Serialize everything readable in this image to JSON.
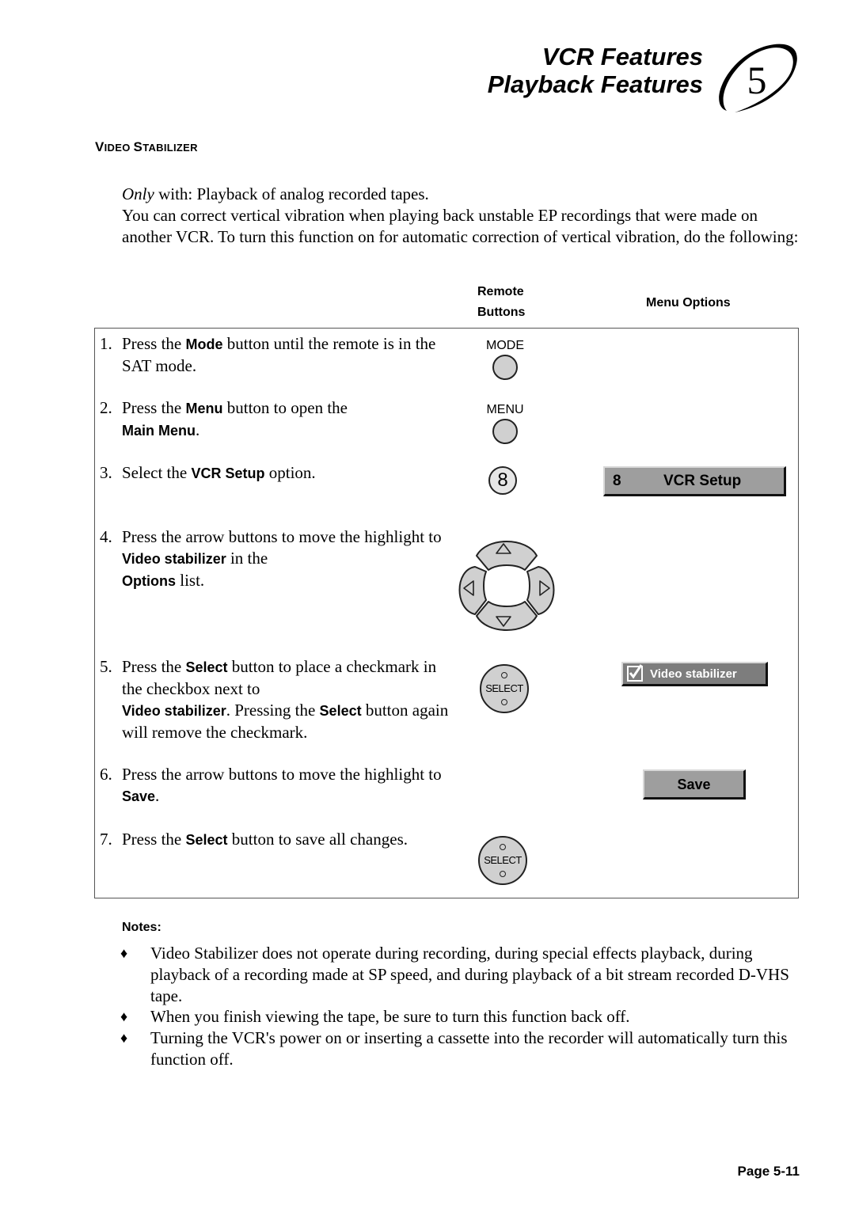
{
  "header": {
    "line1": "VCR Features",
    "line2": "Playback Features",
    "chapter_number": "5"
  },
  "section": {
    "heading_parts": [
      {
        "big": "V",
        "small": "IDEO "
      },
      {
        "big": "S",
        "small": "TABILIZER"
      }
    ]
  },
  "intro": {
    "only_label": "Only",
    "only_rest": " with: Playback of analog recorded tapes.",
    "body": "You can correct vertical vibration when playing back unstable EP recordings that were made on another VCR.  To turn this function on for automatic correction of vertical vibration, do the following:"
  },
  "columns": {
    "remote_line1": "Remote",
    "remote_line2": "Buttons",
    "menu_options": "Menu Options"
  },
  "steps": [
    {
      "num": "1.",
      "parts": [
        [
          "t",
          "Press the "
        ],
        [
          "b",
          "Mode"
        ],
        [
          "t",
          " button until the remote is in the SAT mode."
        ]
      ]
    },
    {
      "num": "2.",
      "parts": [
        [
          "t",
          "Press the "
        ],
        [
          "b",
          "Menu"
        ],
        [
          "t",
          " button to open the "
        ],
        [
          "br",
          ""
        ],
        [
          "b",
          "Main Menu"
        ],
        [
          "t",
          "."
        ]
      ]
    },
    {
      "num": "3.",
      "parts": [
        [
          "t",
          "Select the "
        ],
        [
          "b",
          "VCR Setup"
        ],
        [
          "t",
          " option."
        ]
      ]
    },
    {
      "num": "4.",
      "parts": [
        [
          "t",
          "Press the arrow buttons to move the highlight to "
        ],
        [
          "b",
          "Video stabilizer"
        ],
        [
          "t",
          " in the "
        ],
        [
          "br",
          ""
        ],
        [
          "b",
          "Options"
        ],
        [
          "t",
          " list."
        ]
      ]
    },
    {
      "num": "5.",
      "parts": [
        [
          "t",
          "Press the "
        ],
        [
          "b",
          "Select"
        ],
        [
          "t",
          " button to place a checkmark in the checkbox next to "
        ],
        [
          "br",
          ""
        ],
        [
          "b",
          "Video stabilizer"
        ],
        [
          "t",
          ".  Pressing the "
        ],
        [
          "b",
          "Select"
        ],
        [
          "t",
          " button again will remove the checkmark."
        ]
      ]
    },
    {
      "num": "6.",
      "parts": [
        [
          "t",
          "Press the arrow buttons to move the highlight to "
        ],
        [
          "b",
          "Save"
        ],
        [
          "t",
          "."
        ]
      ]
    },
    {
      "num": "7.",
      "parts": [
        [
          "t",
          "Press the "
        ],
        [
          "b",
          "Select"
        ],
        [
          "t",
          " button to save all changes."
        ]
      ]
    }
  ],
  "remote": {
    "mode_label": "MODE",
    "menu_label": "MENU",
    "number_button": "8",
    "select_label": "SELECT",
    "button_fill": "#d0d0d0"
  },
  "menu_options": {
    "vcr_setup_number": "8",
    "vcr_setup_label": "VCR Setup",
    "video_stabilizer_label": "Video stabilizer",
    "video_stabilizer_checked": true,
    "save_label": "Save",
    "option_fill": "#9e9e9e",
    "highlight_fill": "#7d7d7d"
  },
  "notes": {
    "heading": "Notes:",
    "bullet": "♦",
    "items": [
      "Video Stabilizer does not operate during recording, during special effects playback, during playback of a recording made at SP speed, and during playback of a bit stream recorded D-VHS tape.",
      "When you finish viewing the tape, be sure to turn this function back off.",
      "Turning the VCR's power on or inserting a cassette into the recorder will automatically turn this function off."
    ]
  },
  "footer": {
    "page_label": "Page 5-11"
  }
}
